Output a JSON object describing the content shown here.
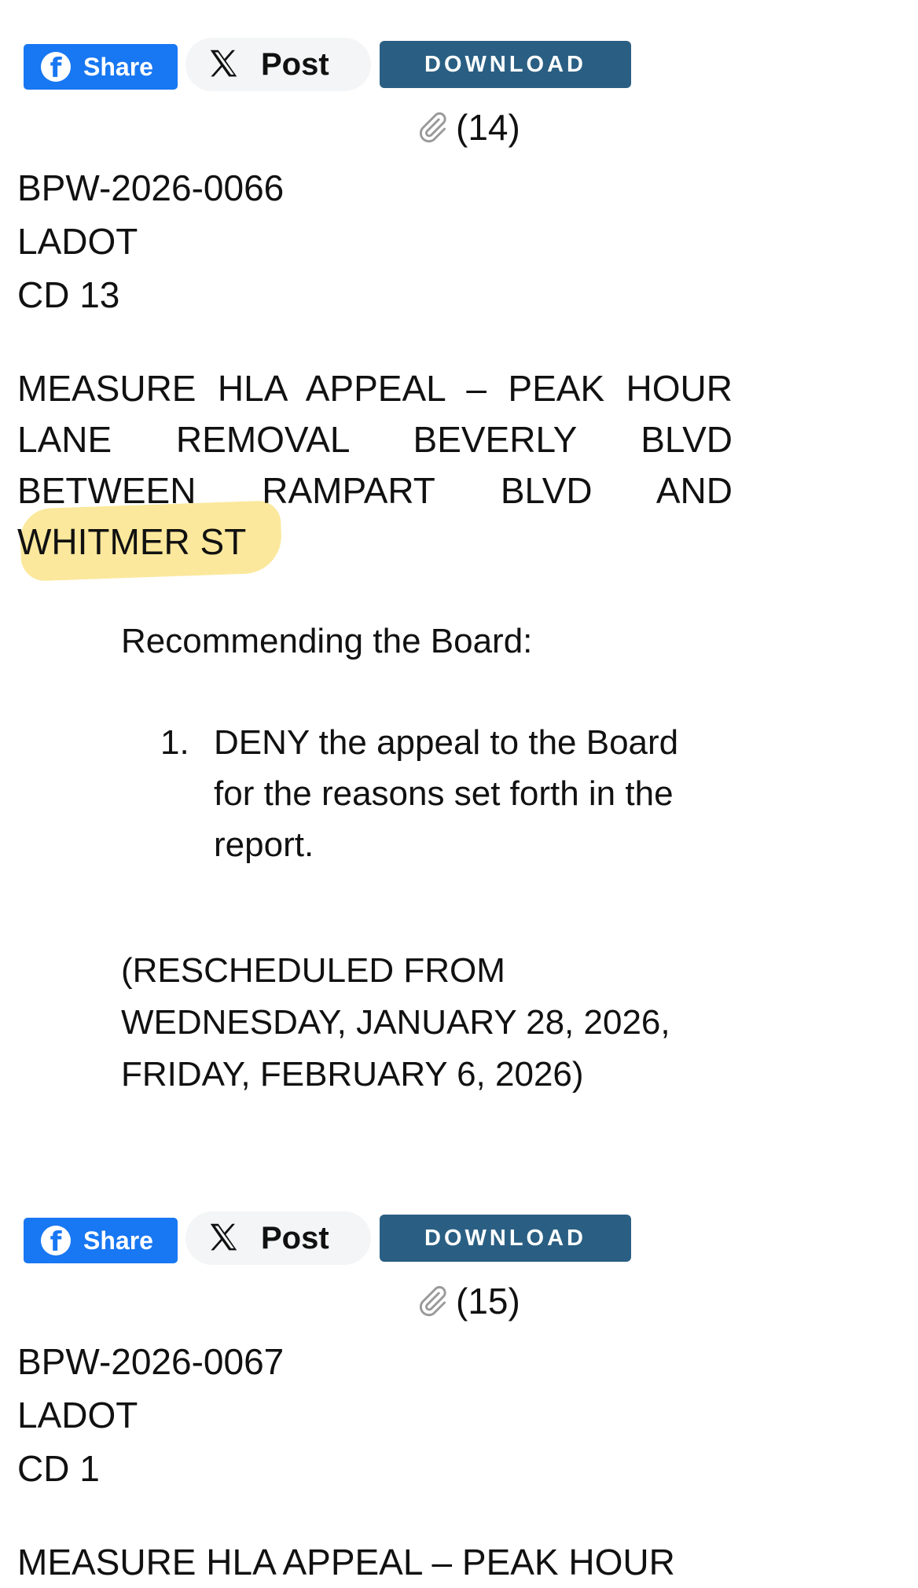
{
  "items": [
    {
      "share_label": "Share",
      "post_label": "Post",
      "download_label": "DOWNLOAD",
      "attachment_count": "(14)",
      "board_number": "BPW-2026-0066",
      "department": "LADOT",
      "district": "CD 13",
      "title": "MEASURE HLA APPEAL – PEAK HOUR LANE REMOVAL BEVERLY BLVD BETWEEN RAMPART BLVD AND WHITMER ST",
      "recommend_heading": "Recommending the Board:",
      "recommendations": [
        {
          "number": "1.",
          "text": "DENY the appeal to the Board for the reasons set forth in the report."
        }
      ],
      "reschedule_note": "(RESCHEDULED FROM WEDNESDAY, JANUARY 28, 2026, FRIDAY, FEBRUARY 6, 2026)"
    },
    {
      "share_label": "Share",
      "post_label": "Post",
      "download_label": "DOWNLOAD",
      "attachment_count": "(15)",
      "board_number": "BPW-2026-0067",
      "department": "LADOT",
      "district": "CD 1",
      "title": "MEASURE HLA APPEAL – PEAK HOUR"
    }
  ],
  "colors": {
    "facebook_blue": "#1877f2",
    "download_blue": "#2a5f83",
    "post_bg": "#f4f5f6",
    "highlight_yellow": "#fbe591"
  },
  "icons": [
    "facebook-icon",
    "x-logo-icon",
    "paperclip-icon"
  ]
}
